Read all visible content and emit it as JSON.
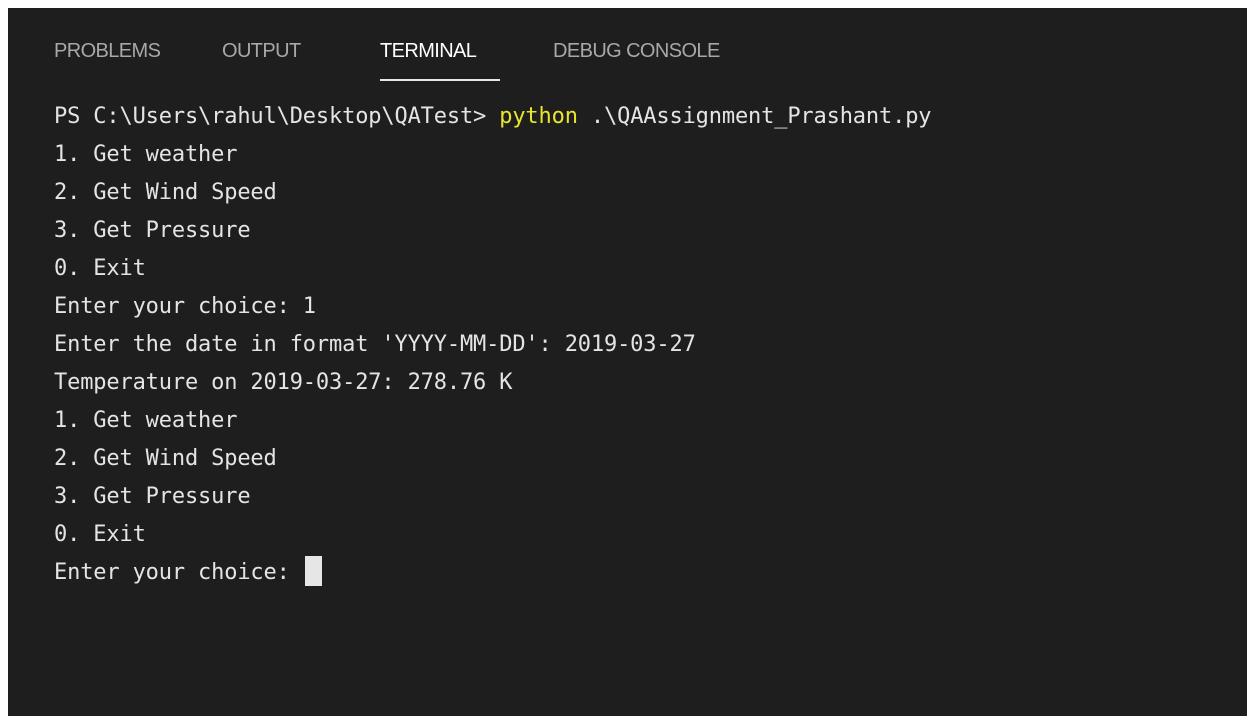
{
  "tabs": [
    {
      "label": "PROBLEMS",
      "active": false
    },
    {
      "label": "OUTPUT",
      "active": false
    },
    {
      "label": "TERMINAL",
      "active": true
    },
    {
      "label": "DEBUG CONSOLE",
      "active": false
    }
  ],
  "terminal": {
    "prompt": "PS C:\\Users\\rahul\\Desktop\\QATest> ",
    "command": "python",
    "args": " .\\QAAssignment_Prashant.py",
    "lines": [
      "1. Get weather",
      "2. Get Wind Speed",
      "3. Get Pressure",
      "0. Exit",
      "Enter your choice: 1",
      "Enter the date in format 'YYYY-MM-DD': 2019-03-27",
      "Temperature on 2019-03-27: 278.76 K",
      "1. Get weather",
      "2. Get Wind Speed",
      "3. Get Pressure",
      "0. Exit"
    ],
    "input_prompt": "Enter your choice: "
  },
  "colors": {
    "background": "#1e1e1e",
    "text": "#e4e4e4",
    "command": "#e9e52c",
    "tab_inactive": "#a8a8a8",
    "tab_active": "#ffffff"
  }
}
